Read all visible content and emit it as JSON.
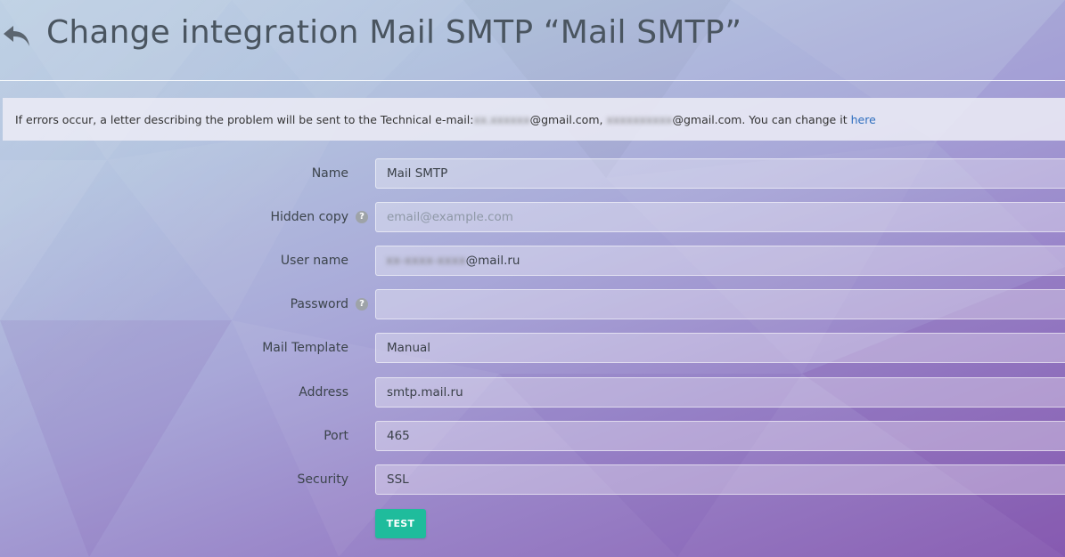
{
  "header": {
    "title": "Change integration Mail SMTP “Mail SMTP”",
    "back_icon": "undo-arrow-icon"
  },
  "notice": {
    "text_before": "If errors occur, a letter describing the problem will be sent to the Technical e-mail: ",
    "email1_hidden": "xx.xxxxxx",
    "email1_domain": "@gmail.com,",
    "email2_hidden": "xxxxxxxxxx",
    "email2_domain": "@gmail.com. You can change it",
    "link_text": "here"
  },
  "form": {
    "name": {
      "label": "Name",
      "value": "Mail SMTP"
    },
    "hidden_copy": {
      "label": "Hidden copy",
      "placeholder": "email@example.com",
      "value": ""
    },
    "user_name": {
      "label": "User name",
      "hidden_part": "xx-xxxx-xxxx",
      "domain": "@mail.ru"
    },
    "password": {
      "label": "Password",
      "value": ""
    },
    "mail_template": {
      "label": "Mail Template",
      "value": "Manual"
    },
    "address": {
      "label": "Address",
      "value": "smtp.mail.ru"
    },
    "port": {
      "label": "Port",
      "value": "465"
    },
    "security": {
      "label": "Security",
      "value": "SSL"
    },
    "help_glyph": "?",
    "help_icon": "question-circle-icon"
  },
  "buttons": {
    "test_label": "TEST"
  },
  "colors": {
    "accent": "#1fbc9c",
    "link": "#2f6fbf",
    "title": "#4a5560"
  }
}
